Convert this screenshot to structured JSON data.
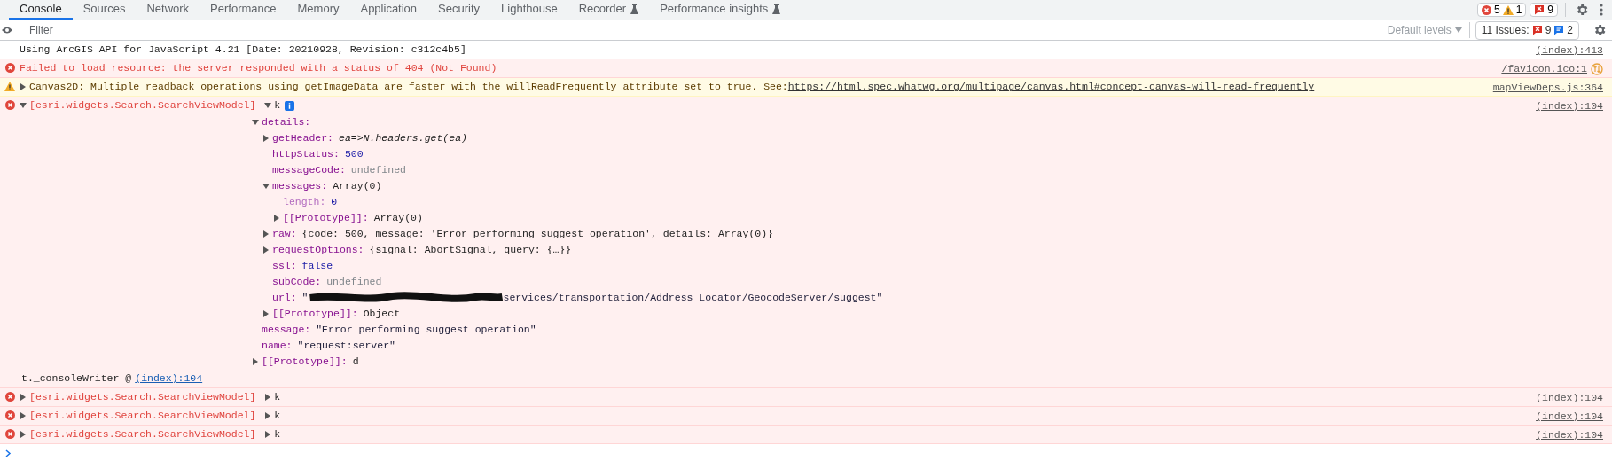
{
  "tabs": [
    {
      "label": "Console",
      "selected": true
    },
    {
      "label": "Sources",
      "selected": false
    },
    {
      "label": "Network",
      "selected": false
    },
    {
      "label": "Performance",
      "selected": false
    },
    {
      "label": "Memory",
      "selected": false
    },
    {
      "label": "Application",
      "selected": false
    },
    {
      "label": "Security",
      "selected": false
    },
    {
      "label": "Lighthouse",
      "selected": false
    },
    {
      "label": "Recorder",
      "selected": false,
      "experimental": true
    },
    {
      "label": "Performance insights",
      "selected": false,
      "experimental": true
    }
  ],
  "counters": {
    "errors": "5",
    "warnings": "1",
    "issues": "9"
  },
  "filter_bar": {
    "placeholder": "Filter",
    "levels": "Default levels",
    "issues_label": "11 Issues:",
    "issue_errors": "9",
    "issue_info": "2"
  },
  "messages": [
    {
      "kind": "log",
      "text": "Using ArcGIS API for JavaScript 4.21 [Date: 20210928, Revision: c312c4b5]",
      "source": "(index):413"
    },
    {
      "kind": "error",
      "text": "Failed to load resource: the server responded with a status of 404 (Not Found)",
      "source": "/favicon.ico:1",
      "network": true
    },
    {
      "kind": "warning",
      "expanded": false,
      "text": "Canvas2D: Multiple readback operations using getImageData are faster with the willReadFrequently attribute set to true. See: ",
      "link": "https://html.spec.whatwg.org/multipage/canvas.html#concept-canvas-will-read-frequently",
      "source": "mapViewDeps.js:364"
    },
    {
      "kind": "error",
      "expanded": true,
      "label": "[esri.widgets.Search.SearchViewModel]",
      "object": {
        "key": "k",
        "expanded": true,
        "children": [
          {
            "key": "details:",
            "expanded": true,
            "children": [
              {
                "key": "getHeader:",
                "kind": "function",
                "value": "ea=>N.headers.get(ea)",
                "expanded": false
              },
              {
                "key": "httpStatus:",
                "kind": "number",
                "value": "500"
              },
              {
                "key": "messageCode:",
                "kind": "undefined",
                "value": "undefined"
              },
              {
                "key": "messages:",
                "kind": "plain",
                "value": "Array(0)",
                "expanded": true,
                "children": [
                  {
                    "key": "length:",
                    "kind": "number",
                    "value": "0",
                    "internal": true
                  },
                  {
                    "key": "[[Prototype]]:",
                    "kind": "plain",
                    "value": "Array(0)",
                    "expanded": false
                  }
                ]
              },
              {
                "key": "raw:",
                "kind": "plain",
                "value": "{code: 500, message: 'Error performing suggest operation', details: Array(0)}",
                "expanded": false
              },
              {
                "key": "requestOptions:",
                "kind": "plain",
                "value": "{signal: AbortSignal, query: {…}}",
                "expanded": false
              },
              {
                "key": "ssl:",
                "kind": "bool",
                "value": "false"
              },
              {
                "key": "subCode:",
                "kind": "undefined",
                "value": "undefined"
              },
              {
                "key": "url:",
                "kind": "string",
                "value": "\"",
                "redacted": true,
                "rest": "services/transportation/Address_Locator/GeocodeServer/suggest\""
              },
              {
                "key": "[[Prototype]]:",
                "kind": "plain",
                "value": "Object",
                "expanded": false
              }
            ]
          },
          {
            "key": "message:",
            "kind": "string",
            "value": "\"Error performing suggest operation\""
          },
          {
            "key": "name:",
            "kind": "string",
            "value": "\"request:server\""
          },
          {
            "key": "[[Prototype]]:",
            "kind": "plain",
            "value": "d",
            "expanded": false
          }
        ]
      },
      "stack": {
        "text": "t._consoleWriter @ ",
        "link": "(index):104"
      },
      "source": "(index):104"
    },
    {
      "kind": "error",
      "expanded": false,
      "label": "[esri.widgets.Search.SearchViewModel]",
      "object": {
        "key": "k",
        "expanded": false
      },
      "source": "(index):104"
    },
    {
      "kind": "error",
      "expanded": false,
      "label": "[esri.widgets.Search.SearchViewModel]",
      "object": {
        "key": "k",
        "expanded": false
      },
      "source": "(index):104"
    },
    {
      "kind": "error",
      "expanded": false,
      "label": "[esri.widgets.Search.SearchViewModel]",
      "object": {
        "key": "k",
        "expanded": false
      },
      "source": "(index):104"
    }
  ]
}
